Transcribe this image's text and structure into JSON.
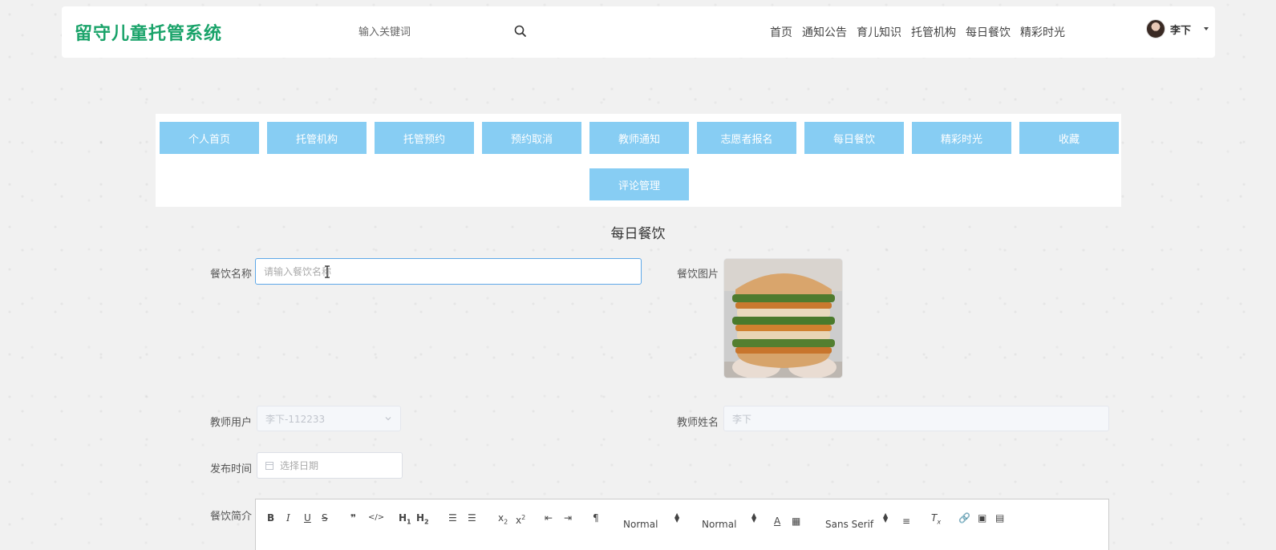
{
  "header": {
    "logo": "留守儿童托管系统",
    "search_placeholder": "输入关键词",
    "nav": [
      "首页",
      "通知公告",
      "育儿知识",
      "托管机构",
      "每日餐饮",
      "精彩时光"
    ],
    "user_name": "李下"
  },
  "menu": {
    "buttons": [
      "个人首页",
      "托管机构",
      "托管预约",
      "预约取消",
      "教师通知",
      "志愿者报名",
      "每日餐饮",
      "精彩时光",
      "收藏",
      "评论管理"
    ]
  },
  "form": {
    "title": "每日餐饮",
    "name_label": "餐饮名称",
    "name_placeholder": "请输入餐饮名称",
    "image_label": "餐饮图片",
    "teacher_user_label": "教师用户",
    "teacher_user_value": "李下-112233",
    "teacher_name_label": "教师姓名",
    "teacher_name_value": "李下",
    "publish_time_label": "发布时间",
    "publish_time_placeholder": "选择日期",
    "intro_label": "餐饮简介"
  },
  "editor": {
    "header_picker": "Normal",
    "size_picker": "Normal",
    "font_picker": "Sans Serif"
  },
  "colors": {
    "brand": "#1aa36a",
    "menu_button": "#87cdf3",
    "focus_border": "#5ea8e8"
  }
}
